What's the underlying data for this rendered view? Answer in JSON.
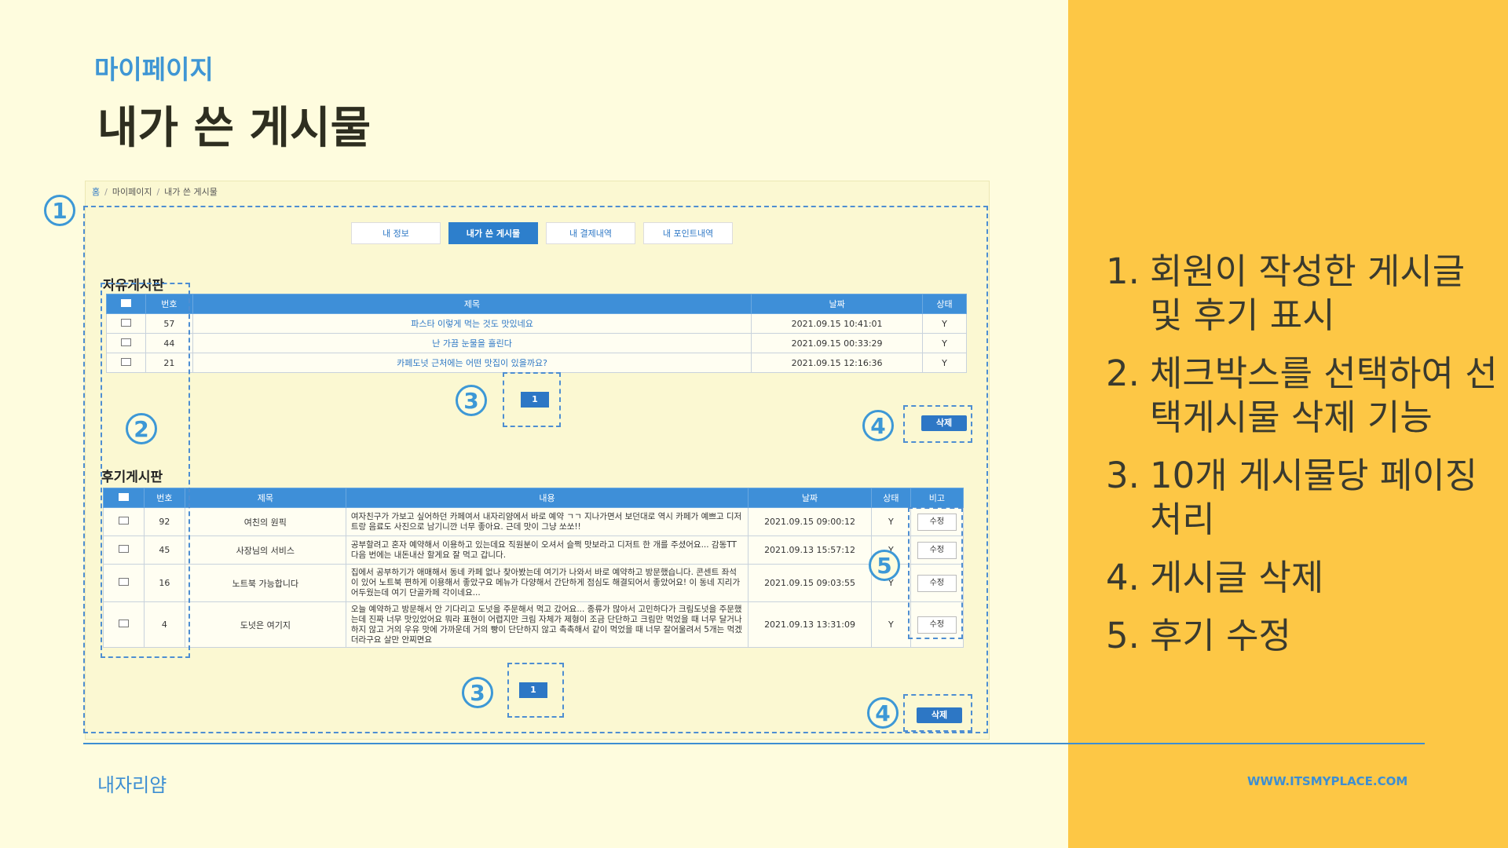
{
  "slide": {
    "subtitle": "마이페이지",
    "title": "내가 쓴 게시물",
    "brand": "내자리얌",
    "url": "WWW.ITSMYPLACE.COM",
    "colors": {
      "accent": "#3d8ed2",
      "right_panel": "#fdc745",
      "background": "#fefcde"
    }
  },
  "breadcrumb": {
    "home": "홈",
    "sep": "/",
    "level1": "마이페이지",
    "level2": "내가 쓴 게시물"
  },
  "tabs": [
    {
      "label": "내 정보",
      "active": false
    },
    {
      "label": "내가 쓴 게시물",
      "active": true
    },
    {
      "label": "내 결제내역",
      "active": false
    },
    {
      "label": "내 포인트내역",
      "active": false
    }
  ],
  "free_board": {
    "title": "자유게시판",
    "headers": {
      "num": "번호",
      "subject": "제목",
      "date": "날짜",
      "status": "상태"
    },
    "rows": [
      {
        "num": "57",
        "subject": "파스타 이렇게 먹는 것도 맛있네요",
        "date": "2021.09.15 10:41:01",
        "status": "Y"
      },
      {
        "num": "44",
        "subject": "난 가끔 눈물을 흘린다",
        "date": "2021.09.15 00:33:29",
        "status": "Y"
      },
      {
        "num": "21",
        "subject": "카페도넛 근처에는 어떤 맛집이 있을까요?",
        "date": "2021.09.15 12:16:36",
        "status": "Y"
      }
    ],
    "page": "1",
    "delete_label": "삭제"
  },
  "review_board": {
    "title": "후기게시판",
    "headers": {
      "num": "번호",
      "subject": "제목",
      "content": "내용",
      "date": "날짜",
      "status": "상태",
      "note": "비고"
    },
    "rows": [
      {
        "num": "92",
        "subject": "여친의 원픽",
        "content": "여자친구가 가보고 싶어하던 카페여서 내자리얌에서 바로 예약 ㄱㄱ 지나가면서 보던대로 역시 카페가 예쁘고 디저트랑 음료도 사진으로 남기니깐 너무 좋아요. 근데 맛이 그냥 쏘쏘!!",
        "date": "2021.09.15 09:00:12",
        "status": "Y",
        "edit": "수정"
      },
      {
        "num": "45",
        "subject": "사장님의 서비스",
        "content": "공부할려고 혼자 예약해서 이용하고 있는데요 직원분이 오셔서 슬쩍 맛보라고 디저트 한 개를 주셨어요... 감동TT 다음 번에는 내돈내산 할게요 잘 먹고 갑니다.",
        "date": "2021.09.13 15:57:12",
        "status": "Y",
        "edit": "수정"
      },
      {
        "num": "16",
        "subject": "노트북 가능합니다",
        "content": "집에서 공부하기가 애매해서 동네 카페 없나 찾아봤는데 여기가 나와서 바로 예약하고 방문했습니다. 콘센트 좌석이 있어 노트북 편하게 이용해서 좋았구요 메뉴가 다양해서 간단하게 점심도 해결되어서 좋았어요! 이 동네 지리가 어두웠는데 여기 단골카페 각이네요...",
        "date": "2021.09.15 09:03:55",
        "status": "Y",
        "edit": "수정"
      },
      {
        "num": "4",
        "subject": "도넛은 여기지",
        "content": "오늘 예약하고 방문해서 안 기다리고 도넛을 주문해서 먹고 갔어요... 종류가 많아서 고민하다가 크림도넛을 주문했는데 진짜 너무 맛있었어요 뭐라 표현이 어렵지만 크림 자체가 제형이 조금 단단하고 크림만 먹었을 때 너무 달거나 하지 않고 거의 우유 맛에 가까운데 거의 빵이 단단하지 않고 촉촉해서 같이 먹었을 때 너무 잘어울려서 5개는 먹겠더라구요 살만 안찌면요",
        "date": "2021.09.13 13:31:09",
        "status": "Y",
        "edit": "수정"
      }
    ],
    "page": "1",
    "delete_label": "삭제"
  },
  "markers": {
    "m1": "1",
    "m2": "2",
    "m3": "3",
    "m4": "4",
    "m5": "5"
  },
  "features": [
    {
      "num": "1.",
      "text": "회원이 작성한 게시글 및 후기 표시"
    },
    {
      "num": "2.",
      "text": "체크박스를 선택하여 선택게시물 삭제 기능"
    },
    {
      "num": "3.",
      "text": "10개 게시물당 페이징 처리"
    },
    {
      "num": "4.",
      "text": "게시글 삭제"
    },
    {
      "num": "5.",
      "text": "후기 수정"
    }
  ]
}
